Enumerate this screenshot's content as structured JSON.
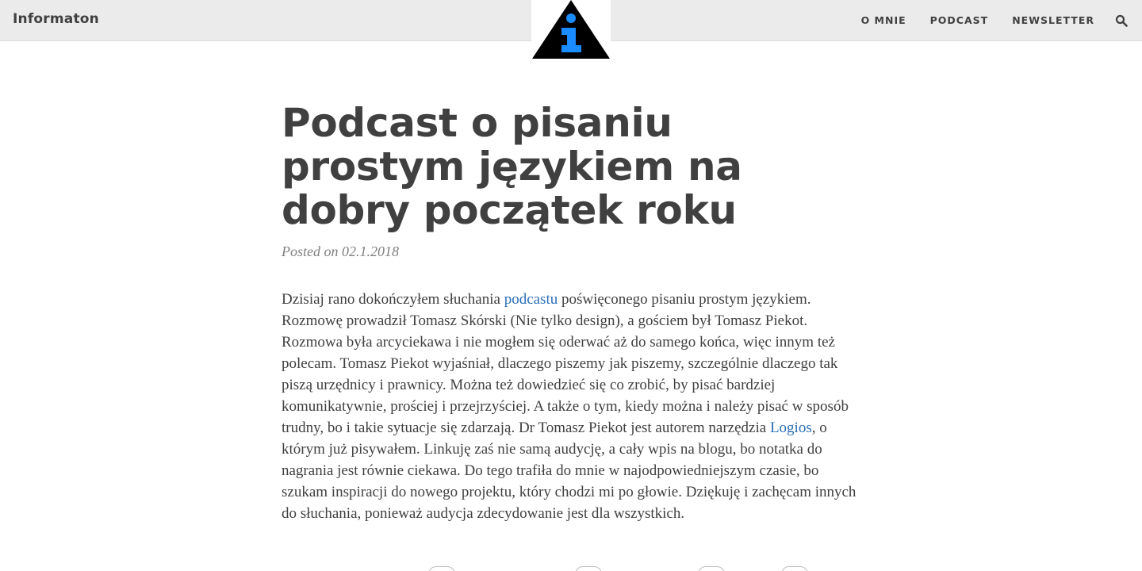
{
  "site": {
    "brand": "Informaton"
  },
  "nav": {
    "items": [
      {
        "label": "O MNIE"
      },
      {
        "label": "PODCAST"
      },
      {
        "label": "NEWSLETTER"
      }
    ]
  },
  "logo": {
    "icon": "information-triangle-icon",
    "colors": {
      "triangle": "#000000",
      "glyph": "#1a8cff"
    }
  },
  "post": {
    "title": "Podcast o pisaniu prostym językiem na dobry początek roku",
    "meta": "Posted on 02.1.2018",
    "body": {
      "p1_a": "Dzisiaj rano dokończyłem słuchania ",
      "link1": "podcastu",
      "p1_b": " poświęconego pisaniu prostym językiem. Rozmowę prowadził Tomasz Skórski (Nie tylko design), a gościem był Tomasz Piekot. Rozmowa była arcyciekawa i nie mogłem się oderwać aż do samego końca, więc innym też polecam. Tomasz Piekot wyjaśniał, dlaczego piszemy jak piszemy, szczególnie dlaczego tak piszą urzędnicy i prawnicy. Można też dowiedzieć się co zrobić, by pisać bardziej komunikatywnie, prościej i przejrzyściej. A także o tym, kiedy można i należy pisać w sposób trudny, bo i takie sytuacje się zdarzają. Dr Tomasz Piekot jest autorem narzędzia ",
      "link2": "Logios",
      "p1_c": ", o którym już pisywałem. Linkuję zaś nie samą audycję, a cały wpis na blogu, bo notatka do nagrania jest równie ciekawa. Do tego trafiła do mnie w najodpowiedniejszym czasie, bo szukam inspiracji do nowego projektu, który chodzi mi po głowie. Dziękuję i zachęcam innych do słuchania, ponieważ audycja zdecydowanie jest dla wszystkich."
    }
  },
  "colors": {
    "navbar_bg": "#ebebeb",
    "text": "#404040",
    "meta": "#808080",
    "link": "#2a6fb8"
  }
}
